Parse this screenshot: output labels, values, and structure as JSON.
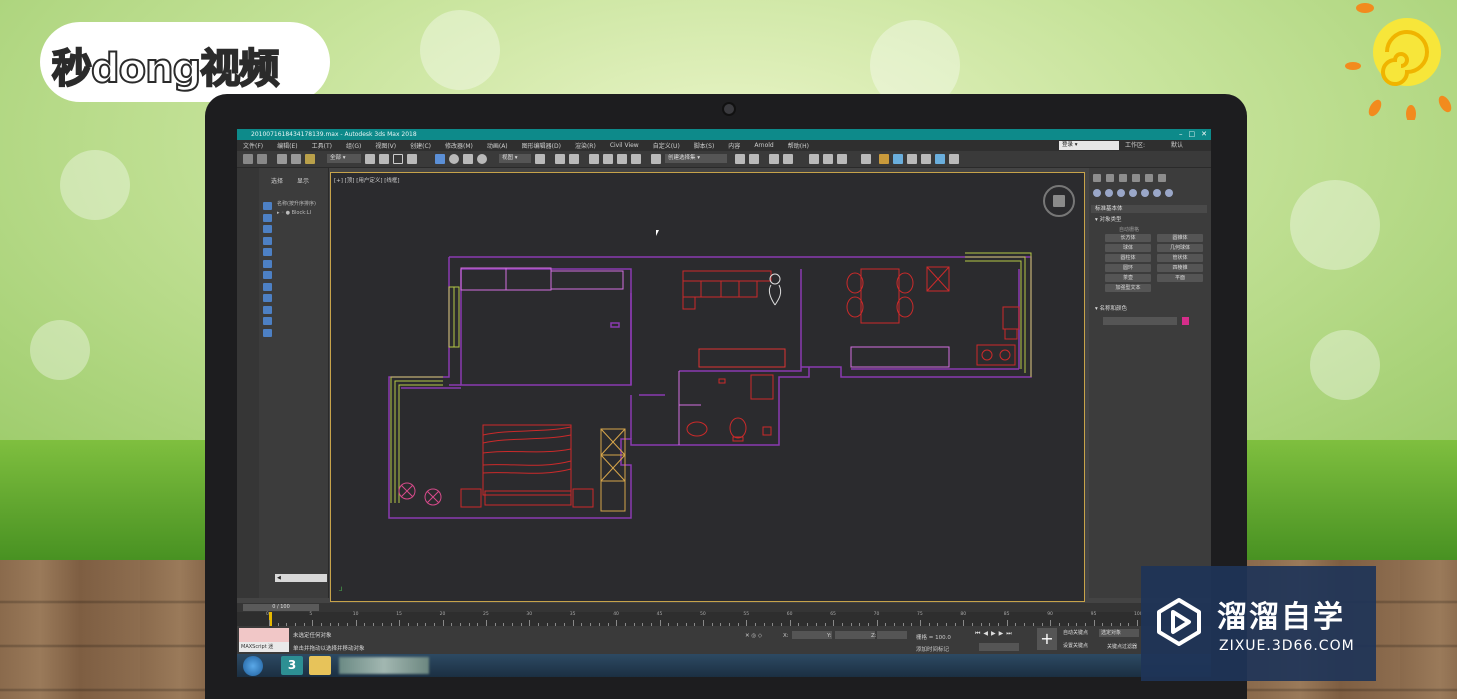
{
  "brand_logo": "秒dong视频",
  "app": {
    "window_title": "2010071618434178139.max - Autodesk 3ds Max 2018"
  },
  "menu": {
    "items": [
      "文件(F)",
      "编辑(E)",
      "工具(T)",
      "组(G)",
      "视图(V)",
      "创建(C)",
      "修改器(M)",
      "动画(A)",
      "图形编辑器(D)",
      "渲染(R)",
      "Civil View",
      "自定义(U)",
      "脚本(S)",
      "内容",
      "Arnold",
      "帮助(H)"
    ],
    "login": "登录",
    "workspace_label": "工作区:",
    "workspace_value": "默认"
  },
  "toolbar": {
    "filter_dropdown": "全部",
    "view_dropdown": "视图",
    "selection_set_dropdown": "创建选择集"
  },
  "explorer": {
    "tabs": [
      "选择",
      "显示"
    ],
    "header": "名称(按升序排序)",
    "row": "Block:LI",
    "scroll_field": "◀"
  },
  "viewport": {
    "label": "[+] [顶] [用户定义] [线框]"
  },
  "command_panel": {
    "category_dropdown": "标准基本体",
    "rollout_object_type": "对象类型",
    "auto_grid": "自动栅格",
    "buttons": [
      "长方体",
      "圆锥体",
      "球体",
      "几何球体",
      "圆柱体",
      "管状体",
      "圆环",
      "四棱锥",
      "茶壶",
      "平面",
      "加强型文本"
    ],
    "rollout_name_color": "名称和颜色",
    "swatch_color": "#d52d8a"
  },
  "timeline": {
    "frame_display": "0 / 100",
    "ruler_labels": [
      "0",
      "5",
      "10",
      "15",
      "20",
      "25",
      "30",
      "35",
      "40",
      "45",
      "50",
      "55",
      "60",
      "65",
      "70",
      "75",
      "80",
      "85",
      "90",
      "95",
      "100"
    ]
  },
  "status": {
    "maxscript_label": "MAXScript 迷",
    "line1": "未选定任何对象",
    "line2": "单击并拖动以选择并移动对象",
    "x_label": "X:",
    "y_label": "Y:",
    "z_label": "Z:",
    "grid": "栅格 = 100.0",
    "add_time_tag": "添加时间标记",
    "auto_key": "自动关键点",
    "set_key": "设置关键点",
    "selected_object": "选定对象",
    "key_filter": "关键点过滤器",
    "frame_value": "0"
  },
  "taskbar": {
    "app_number": "3"
  },
  "watermark": {
    "title": "溜溜自学",
    "url": "ZIXUE.3D66.COM"
  }
}
